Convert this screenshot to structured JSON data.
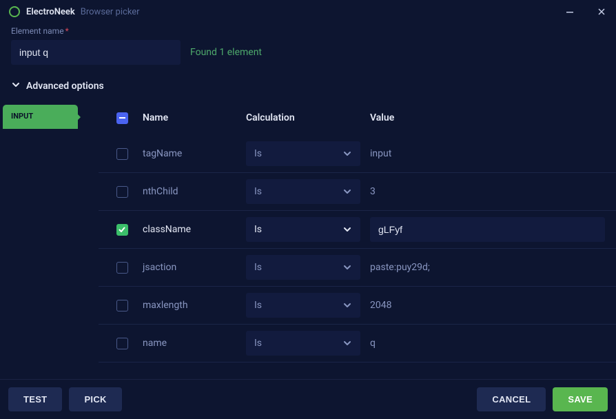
{
  "titlebar": {
    "brand": "ElectroNeek",
    "subtitle": "Browser picker"
  },
  "form": {
    "element_name_label": "Element name",
    "element_name_value": "input q",
    "found_text": "Found 1 element",
    "advanced_label": "Advanced options"
  },
  "sidebar": {
    "tab": "INPUT"
  },
  "table": {
    "headers": {
      "name": "Name",
      "calculation": "Calculation",
      "value": "Value"
    },
    "calc_option": "Is",
    "rows": [
      {
        "checked": false,
        "name": "tagName",
        "value": "input",
        "active": false
      },
      {
        "checked": false,
        "name": "nthChild",
        "value": "3",
        "active": false
      },
      {
        "checked": true,
        "name": "className",
        "value": "gLFyf",
        "active": true
      },
      {
        "checked": false,
        "name": "jsaction",
        "value": "paste:puy29d;",
        "active": false
      },
      {
        "checked": false,
        "name": "maxlength",
        "value": "2048",
        "active": false
      },
      {
        "checked": false,
        "name": "name",
        "value": "q",
        "active": false
      }
    ]
  },
  "footer": {
    "test": "TEST",
    "pick": "PICK",
    "cancel": "CANCEL",
    "save": "SAVE"
  }
}
